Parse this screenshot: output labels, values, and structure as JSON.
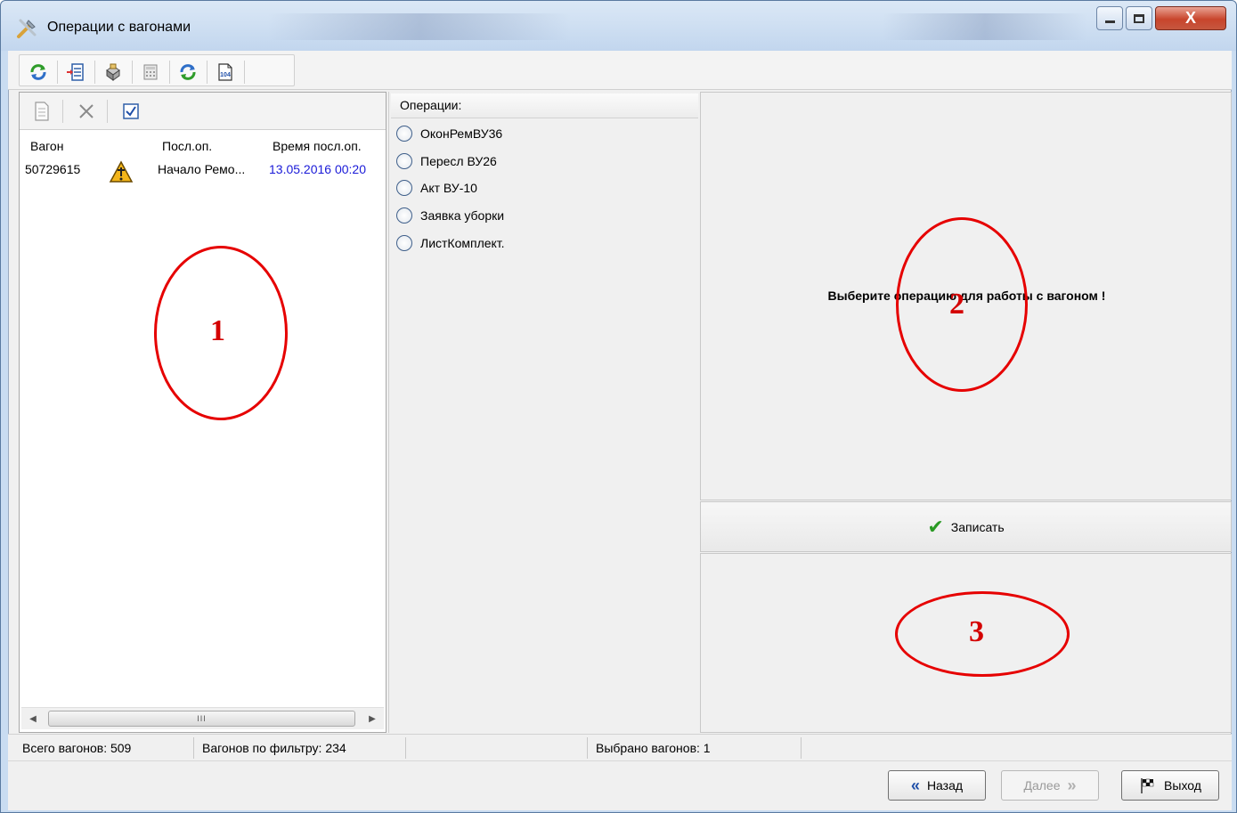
{
  "window": {
    "title": "Операции с вагонами",
    "controls": {
      "minimize": "minimize",
      "maximize": "maximize",
      "close": "X"
    }
  },
  "toolbar": {
    "icons": [
      "refresh-icon",
      "import-list-icon",
      "print-icon",
      "calculator-icon",
      "sync-icon",
      "form-104-icon"
    ],
    "form_label": "104"
  },
  "left_panel": {
    "toolbar_icons": [
      "document-icon",
      "delete-icon",
      "checkbox-icon"
    ],
    "columns": [
      "Вагон",
      "Посл.оп.",
      "Время посл.оп."
    ],
    "rows": [
      {
        "wagon": "50729615",
        "status_icon": "warning-repair-icon",
        "last_op": "Начало Ремо...",
        "last_op_time": "13.05.2016 00:20"
      }
    ],
    "scroll_thumb": "III"
  },
  "operations": {
    "header": "Операции:",
    "items": [
      "ОконРемВУ36",
      "Пересл ВУ26",
      "Акт ВУ-10",
      "Заявка уборки",
      "ЛистКомплект."
    ]
  },
  "right_panel": {
    "prompt": "Выберите операцию для работы с вагоном !",
    "save_label": "Записать"
  },
  "status": {
    "total": "Всего вагонов: 509",
    "filtered": "Вагонов по фильтру: 234",
    "selected": "Выбрано вагонов: 1"
  },
  "buttons": {
    "back": "Назад",
    "next": "Далее",
    "exit": "Выход"
  },
  "annotations": [
    "1",
    "2",
    "3"
  ],
  "colors": {
    "annotation": "#e60000",
    "time_text": "#1a1ad8",
    "accent_blue": "#1f4fa8",
    "check_green": "#2a9a24"
  }
}
